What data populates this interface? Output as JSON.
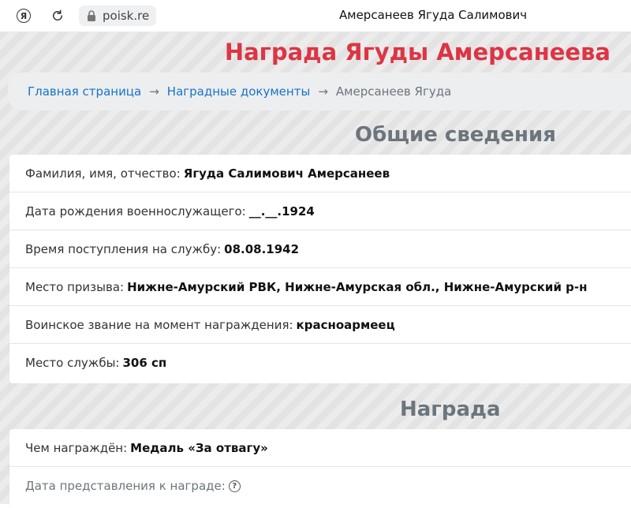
{
  "browser": {
    "url": "poisk.re",
    "tab_title": "Амерсанеев Ягуда Салимович",
    "yandex_icon": "yandex-icon",
    "reload_icon": "reload-icon",
    "lock_icon": "lock-icon"
  },
  "page": {
    "title": "Награда Ягуды Амерсанеева",
    "title_color": "#dc3545"
  },
  "breadcrumb": {
    "items": [
      "Главная страница",
      "Наградные документы"
    ],
    "separator": "→",
    "current": "Амерсанеев Ягуда"
  },
  "general": {
    "heading": "Общие сведения",
    "rows": [
      {
        "label": "Фамилия, имя, отчество:",
        "value": "Ягуда Салимович Амерсанеев"
      },
      {
        "label": "Дата рождения военнослужащего:",
        "value": "__.__.1924"
      },
      {
        "label": "Время поступления на службу:",
        "value": "08.08.1942"
      },
      {
        "label": "Место призыва:",
        "value": "Нижне-Амурский РВК, Нижне-Амурская обл., Нижне-Амурский р-н"
      },
      {
        "label": "Воинское звание на момент награждения:",
        "value": "красноармеец"
      },
      {
        "label": "Место службы:",
        "value": "306 сп"
      }
    ]
  },
  "award": {
    "heading": "Награда",
    "rows": [
      {
        "label": "Чем награждён:",
        "value": "Медаль «За отвагу»"
      },
      {
        "label": "Дата представления к награде:",
        "help_icon": "question-circle-icon"
      }
    ]
  }
}
